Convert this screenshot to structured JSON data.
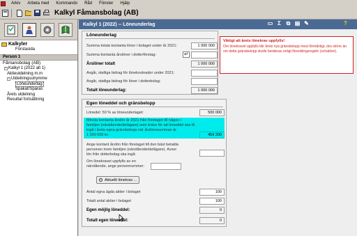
{
  "menubar": {
    "items": [
      "Arkiv",
      "Arbeta med",
      "Kommando",
      "Råd",
      "Fönster",
      "Hjälp"
    ]
  },
  "toolbar": {
    "title": "Kalkyl Fåmansbolag (AB)"
  },
  "sidebar": {
    "tree": [
      {
        "label": "Kalkyler",
        "style": "bold"
      },
      {
        "label": "Förstasida",
        "indent": 20
      },
      {
        "label": "Person 1",
        "style": "hdr"
      },
      {
        "label": "Fåmansbolag (AB)",
        "indent": 2
      },
      {
        "label": "Kalkyl 1 (2022 alt 1)",
        "indent": 4
      },
      {
        "label": "Aktieutdelning m.m",
        "indent": 8
      },
      {
        "label": "Utdelningsutrymme",
        "indent": 8
      },
      {
        "label": "Löneunderlag",
        "indent": 20,
        "selected": true
      },
      {
        "label": "Spakat/Sparas",
        "indent": 20
      },
      {
        "label": "Årets utdelning",
        "indent": 8
      },
      {
        "label": "Resultat fortsättning",
        "indent": 8
      }
    ]
  },
  "window": {
    "title": "Kalkyl 1 (2022) -- Löneunderlag"
  },
  "loneunderlag": {
    "title": "Löneunderlag",
    "rows": [
      {
        "label": "Summa totala kontanta löner i bolaget under år 2021:",
        "value": "1 000 000"
      },
      {
        "label": "Summa kontanta årslöner i dotterföretag:",
        "value": "",
        "has_button": true
      },
      {
        "label": "Årslöner totalt",
        "value": "1 000 000",
        "bold": true
      },
      {
        "label": "Avgår, statliga bidrag för lönekostnader under 2021:",
        "value": ""
      },
      {
        "label": "Avgår, statliga bidrag för löner i dotterbolag:",
        "value": ""
      },
      {
        "label": "Totalt löneunderlag:",
        "value": "1 000 000",
        "bold": true
      }
    ],
    "add_button": "↵"
  },
  "warning": {
    "title": "Viktigt att årets lönekrav uppfylls!",
    "text": "Om lönekravet uppfylls blir årets nya gränsbelopp mest förmånligt, dvs större än om detta gränsbelopp skulle beräknas enligt förenklingsregeln (schablon)."
  },
  "egen": {
    "title": "Egen löneddel och gränsbelopp",
    "row1_label": "Lönedel: 50 % av löneunderlaget:",
    "row1_value": "500 000",
    "hl_lines": [
      "Minsta kontanta årslön år 2021 från företaget till någon i",
      "familjen (närstående/delägare) som krävs för att löneddel ska få",
      "ingå i årets egna gränsbelopp när årslönesumman är",
      "1 000 000 kr:"
    ],
    "hl_value": "459 200",
    "own_salary_label_1": "Ange kontant årslön från företaget till den bäst betalda",
    "own_salary_label_2": "personen inom familjen (närstående/delägare). Avser",
    "own_salary_label_3": "lön från dotterbolag ska ingå:",
    "req_label_1": "Om lönekravet uppfylls av en",
    "req_label_2": "närstående, ange personnummer:",
    "calc_button": "Aktuellt lönekrav ...",
    "shares_own_label": "Antal egna ägda aktier i bolaget",
    "shares_own_value": "100",
    "shares_total_label": "Totalt antal aktier i bolaget",
    "shares_total_value": "100",
    "possible_label": "Egen möjlig löneddel:",
    "possible_value": "0",
    "total_label": "Totalt egen löneddel:",
    "total_value": "0"
  }
}
